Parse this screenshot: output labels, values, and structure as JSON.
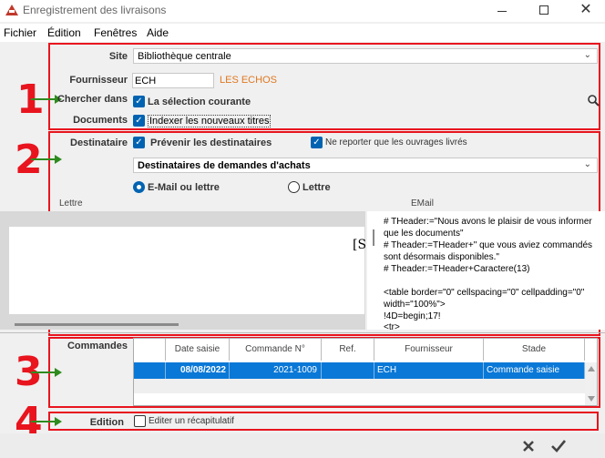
{
  "window": {
    "title": "Enregistrement des livraisons",
    "minimize": "—",
    "maximize": "□",
    "close": "✕"
  },
  "menu": [
    "Fichier",
    "Édition",
    "Fenêtres",
    "Aide"
  ],
  "section1": {
    "site_label": "Site",
    "site_value": "Bibliothèque centrale",
    "supplier_label": "Fournisseur",
    "supplier_code": "ECH",
    "supplier_name": "LES ECHOS",
    "search_label": "Chercher dans",
    "search_option": "La sélection courante",
    "docs_label": "Documents",
    "docs_option": "Indexer les nouveaux titres"
  },
  "section2": {
    "recipient_label": "Destinataire",
    "notify": "Prévenir les destinataires",
    "only_delivered": "Ne reporter que les ouvrages livrés",
    "template": "Destinataires de demandes d'achats",
    "radio_email_letter": "E-Mail ou lettre",
    "radio_letter": "Lettre",
    "col_letter": "Lettre",
    "col_email": "EMail",
    "letter_preview": "[S",
    "email_lines": [
      "# THeader:=\"Nous avons le plaisir de vous informer",
      "que les documents\"",
      "# Theader:=THeader+\" que vous aviez commandés",
      "sont désormais disponibles.\"",
      "# Theader:=THeader+Caractere(13)",
      "",
      "<table border=\"0\" cellspacing=\"0\" cellpadding=\"0\"",
      "width=\"100%\">",
      "!4D=begin;17!",
      "<tr>"
    ]
  },
  "section3": {
    "label": "Commandes",
    "columns": [
      "Date saisie",
      "Commande N°",
      "Ref.",
      "Fournisseur",
      "Stade"
    ],
    "rows": [
      {
        "date": "08/08/2022",
        "order": "2021-1009",
        "ref": "",
        "supplier": "ECH",
        "stage": "Commande saisie"
      }
    ]
  },
  "section4": {
    "label": "Edition",
    "option": "Editer un récapitulatif"
  },
  "annotations": [
    "1",
    "2",
    "3",
    "4"
  ],
  "colors": {
    "annotation": "#e8141e",
    "arrow": "#2e8b1e",
    "accent": "#0063b1",
    "selected_row": "#0a78d7"
  },
  "icons": {
    "search": "magnifier-icon",
    "cancel": "close-icon",
    "validate": "check-icon"
  }
}
